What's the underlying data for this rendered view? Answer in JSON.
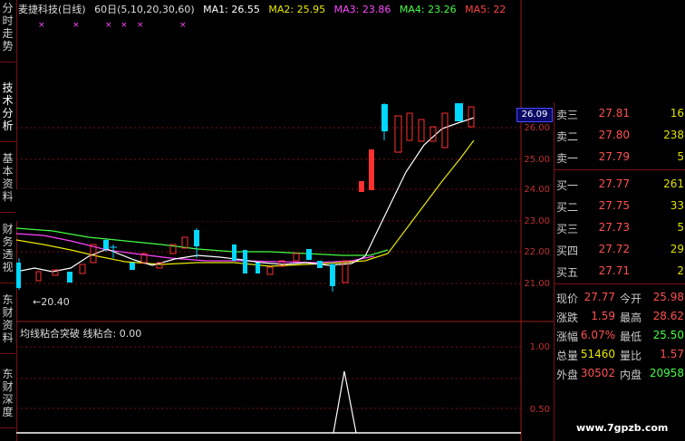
{
  "tabs": [
    {
      "label": "分时走势",
      "active": false
    },
    {
      "label": "技术分析",
      "active": true
    },
    {
      "label": "基本资料",
      "active": false
    },
    {
      "label": "财务透视",
      "active": false
    },
    {
      "label": "东财资料",
      "active": false
    },
    {
      "label": "东财深度",
      "active": false
    }
  ],
  "header": {
    "stock": "麦捷科技(日线)",
    "period": "60日(5,10,20,30,60)",
    "ma1": {
      "label": "MA1:",
      "value": "26.55",
      "color": "#ffffff"
    },
    "ma2": {
      "label": "MA2:",
      "value": "25.95",
      "color": "#e8e800"
    },
    "ma3": {
      "label": "MA3:",
      "value": "23.86",
      "color": "#ff44ff"
    },
    "ma4": {
      "label": "MA4:",
      "value": "23.26",
      "color": "#44ff44"
    },
    "ma5": {
      "label": "MA5:",
      "value": "22",
      "color": "#ff4444"
    }
  },
  "price_axis": [
    "26.00",
    "25.00",
    "24.00",
    "23.00",
    "22.00",
    "21.00"
  ],
  "current_price_tag": "26.09",
  "min_marker": "←20.40",
  "indicator": {
    "label": "均线粘合突破 线粘合: 0.00",
    "axis": [
      "1.00",
      "0.50"
    ]
  },
  "quote": {
    "asks": [
      {
        "label": "卖三",
        "price": "27.81",
        "vol": "16"
      },
      {
        "label": "卖二",
        "price": "27.80",
        "vol": "238"
      },
      {
        "label": "卖一",
        "price": "27.79",
        "vol": "5"
      }
    ],
    "bids": [
      {
        "label": "买一",
        "price": "27.77",
        "vol": "261"
      },
      {
        "label": "买二",
        "price": "27.75",
        "vol": "33"
      },
      {
        "label": "买三",
        "price": "27.73",
        "vol": "5"
      },
      {
        "label": "买四",
        "price": "27.72",
        "vol": "29"
      },
      {
        "label": "买五",
        "price": "27.71",
        "vol": "2"
      }
    ],
    "stats": [
      {
        "k1": "现价",
        "v1": "27.77",
        "k2": "今开",
        "v2": "25.98",
        "c2": "#ff5050"
      },
      {
        "k1": "涨跌",
        "v1": "1.59",
        "k2": "最高",
        "v2": "28.62",
        "c2": "#ff5050"
      },
      {
        "k1": "涨幅",
        "v1": "6.07%",
        "k2": "最低",
        "v2": "25.50",
        "c2": "#44ff44"
      },
      {
        "k1": "总量",
        "v1": "51460",
        "k2": "量比",
        "v2": "1.57",
        "c2": "#ff5050"
      },
      {
        "k1": "外盘",
        "v1": "30502",
        "k2": "内盘",
        "v2": "20958",
        "c2": "#44ff44"
      }
    ]
  },
  "watermark": "www.7gpzb.com"
}
